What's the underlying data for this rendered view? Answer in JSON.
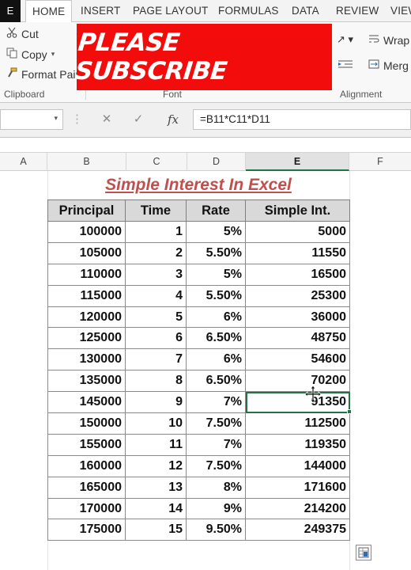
{
  "ribbon": {
    "file_tab": "E",
    "tabs": [
      "HOME",
      "INSERT",
      "PAGE LAYOUT",
      "FORMULAS",
      "DATA",
      "REVIEW",
      "VIEW"
    ],
    "cut_label": "Cut",
    "copy_label": "Copy",
    "format_painter_label": "Format Pain",
    "clipboard_group": "Clipboard",
    "font_group": "Font",
    "alignment_group": "Alignment",
    "wrap_label": "Wrap",
    "merge_label": "Merg"
  },
  "overlay": {
    "text": "PLEASE SUBSCRIBE",
    "color": "#f20c0c"
  },
  "formula_bar": {
    "fx": "fx",
    "formula": "=B11*C11*D11"
  },
  "columns": [
    "A",
    "B",
    "C",
    "D",
    "E",
    "F"
  ],
  "sheet": {
    "title": "Simple Interest In Excel",
    "headers": [
      "Principal",
      "Time",
      "Rate",
      "Simple Int."
    ],
    "rows": [
      [
        "100000",
        "1",
        "5%",
        "5000"
      ],
      [
        "105000",
        "2",
        "5.50%",
        "11550"
      ],
      [
        "110000",
        "3",
        "5%",
        "16500"
      ],
      [
        "115000",
        "4",
        "5.50%",
        "25300"
      ],
      [
        "120000",
        "5",
        "6%",
        "36000"
      ],
      [
        "125000",
        "6",
        "6.50%",
        "48750"
      ],
      [
        "130000",
        "7",
        "6%",
        "54600"
      ],
      [
        "135000",
        "8",
        "6.50%",
        "70200"
      ],
      [
        "145000",
        "9",
        "7%",
        "91350"
      ],
      [
        "150000",
        "10",
        "7.50%",
        "112500"
      ],
      [
        "155000",
        "11",
        "7%",
        "119350"
      ],
      [
        "160000",
        "12",
        "7.50%",
        "144000"
      ],
      [
        "165000",
        "13",
        "8%",
        "171600"
      ],
      [
        "170000",
        "14",
        "9%",
        "214200"
      ],
      [
        "175000",
        "15",
        "9.50%",
        "249375"
      ]
    ]
  },
  "accent": "#217346",
  "title_color": "#c0504d"
}
